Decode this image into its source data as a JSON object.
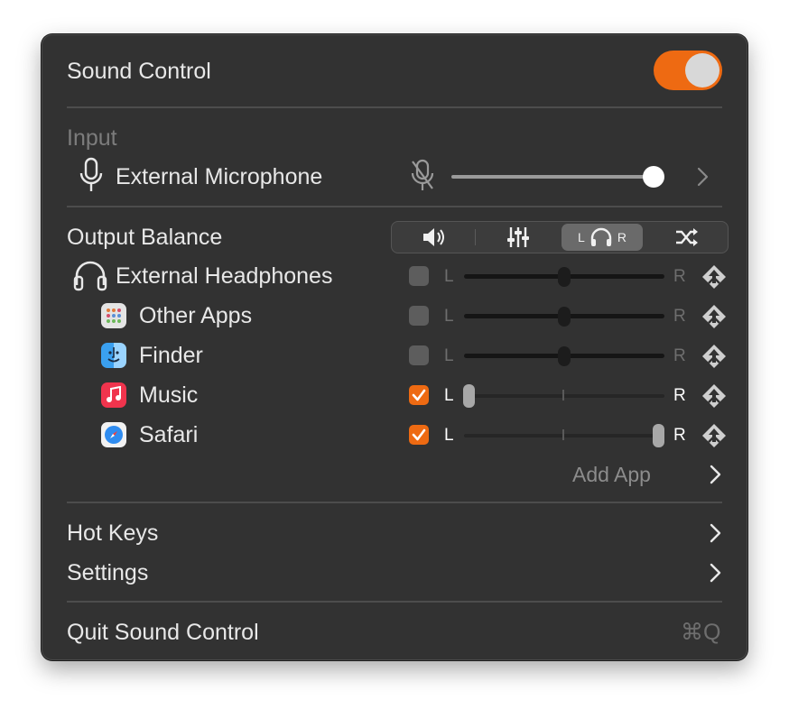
{
  "title": "Sound Control",
  "toggle_on": true,
  "input": {
    "section_label": "Input",
    "device": "External Microphone",
    "volume": 1.0
  },
  "output": {
    "section_label": "Output Balance",
    "modes": [
      "volume-icon",
      "equalizer-icon",
      "headphone-balance-icon",
      "shuffle-icon"
    ],
    "active_mode": 2,
    "mode_left": "L",
    "mode_right": "R",
    "device": "External Headphones",
    "apps": [
      {
        "name": "Other Apps",
        "checked": false,
        "balance": 0.5,
        "left": "L",
        "right": "R"
      },
      {
        "name": "Finder",
        "checked": false,
        "balance": 0.5,
        "left": "L",
        "right": "R"
      },
      {
        "name": "Music",
        "checked": true,
        "balance": 0.0,
        "left": "L",
        "right": "R"
      },
      {
        "name": "Safari",
        "checked": true,
        "balance": 1.0,
        "left": "L",
        "right": "R"
      }
    ],
    "device_row": {
      "checked": false,
      "balance": 0.5,
      "left": "L",
      "right": "R"
    },
    "add_app": "Add App"
  },
  "menu": {
    "hot_keys": "Hot Keys",
    "settings": "Settings",
    "quit": "Quit Sound Control",
    "quit_shortcut": "⌘Q"
  },
  "colors": {
    "accent": "#ee6a12",
    "panel": "#323232",
    "text": "#e8e8e8"
  }
}
